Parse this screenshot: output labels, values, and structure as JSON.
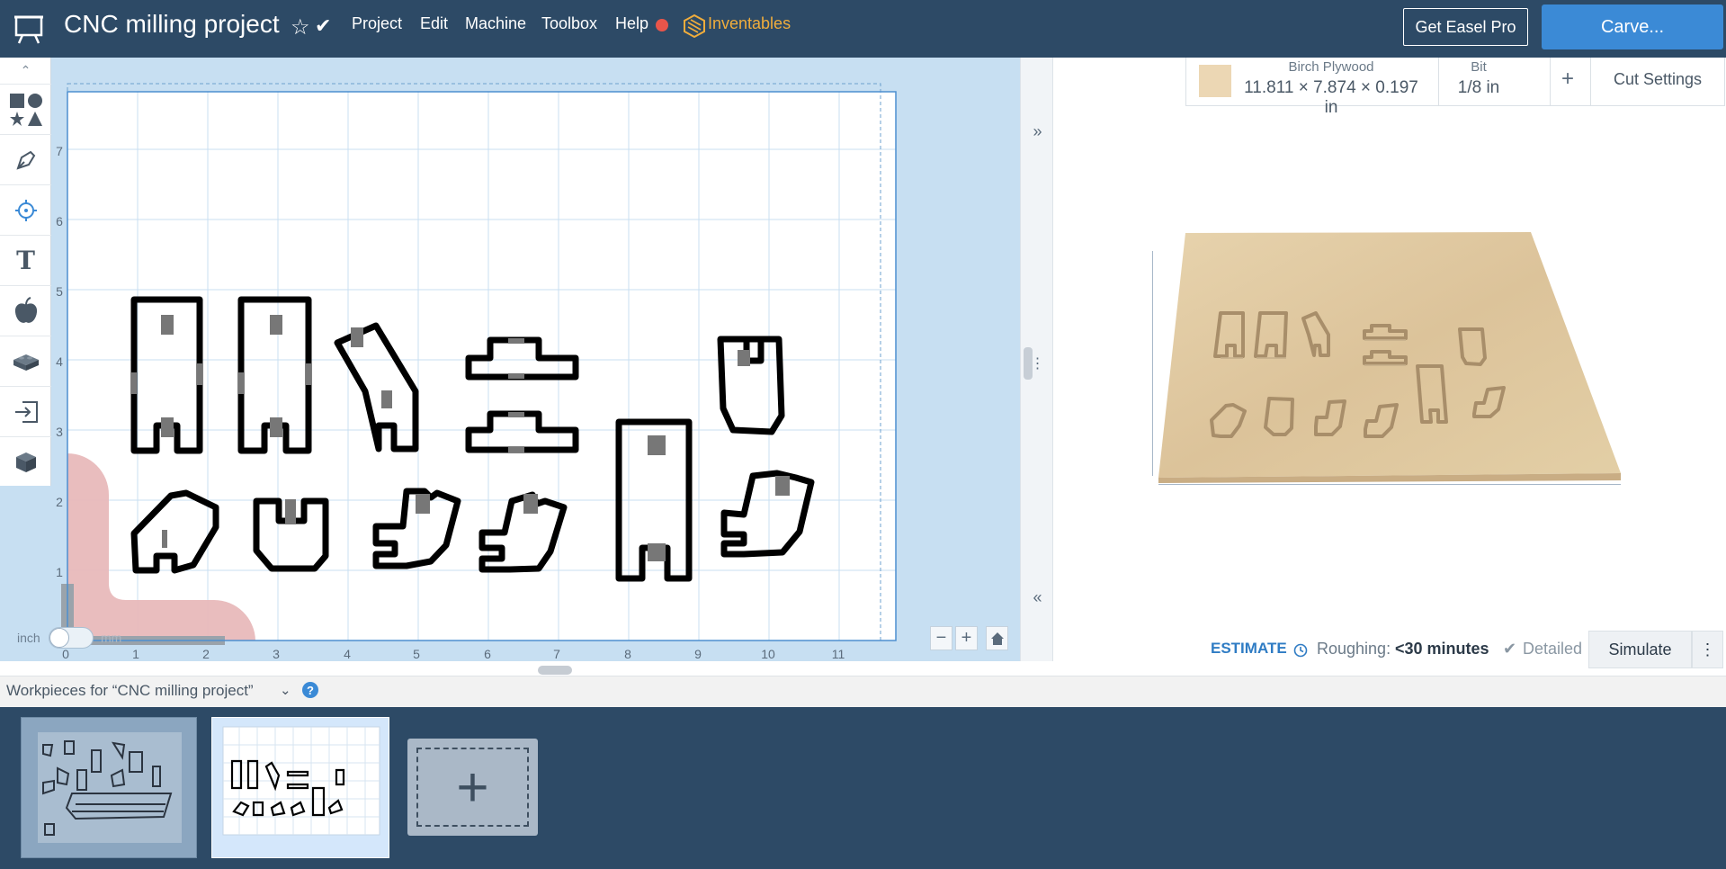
{
  "header": {
    "project_title": "CNC milling project",
    "menu": [
      "Project",
      "Edit",
      "Machine",
      "Toolbox",
      "Help"
    ],
    "brand_label": "Inventables",
    "pro_button": "Get Easel Pro",
    "carve_button": "Carve..."
  },
  "toolbar": {
    "tools": [
      "shapes-icon",
      "pen-icon",
      "point-icon",
      "text-icon",
      "apple-icon",
      "brick-icon",
      "import-icon",
      "cube-icon"
    ],
    "text_tool_glyph": "T"
  },
  "canvas": {
    "x_ticks": [
      "0",
      "1",
      "2",
      "3",
      "4",
      "5",
      "6",
      "7",
      "8",
      "9",
      "10",
      "11"
    ],
    "y_ticks": [
      "1",
      "2",
      "3",
      "4",
      "5",
      "6",
      "7"
    ],
    "unit_inch": "inch",
    "unit_mm": "mm",
    "zoom_out": "−",
    "zoom_in": "+",
    "home": "⌂"
  },
  "material": {
    "name": "Birch Plywood",
    "dimensions": "11.811 × 7.874 × 0.197 in",
    "bit_label": "Bit",
    "bit_value": "1/8 in",
    "add": "+",
    "cut_settings": "Cut Settings",
    "swatch_color": "#ecd7b4"
  },
  "estimate": {
    "label": "ESTIMATE",
    "roughing_label": "Roughing:",
    "roughing_value": "<30 minutes",
    "detailed_label": "Detailed",
    "simulate_button": "Simulate",
    "more": "⋮"
  },
  "workpieces": {
    "title": "Workpieces for “CNC milling project”",
    "help": "?",
    "add": "+"
  },
  "colors": {
    "topbar": "#2d4a66",
    "accent": "#3b8ad6",
    "inventables": "#f0ad3c",
    "record_dot": "#e9554a",
    "canvas_bg": "#c7dff2"
  }
}
